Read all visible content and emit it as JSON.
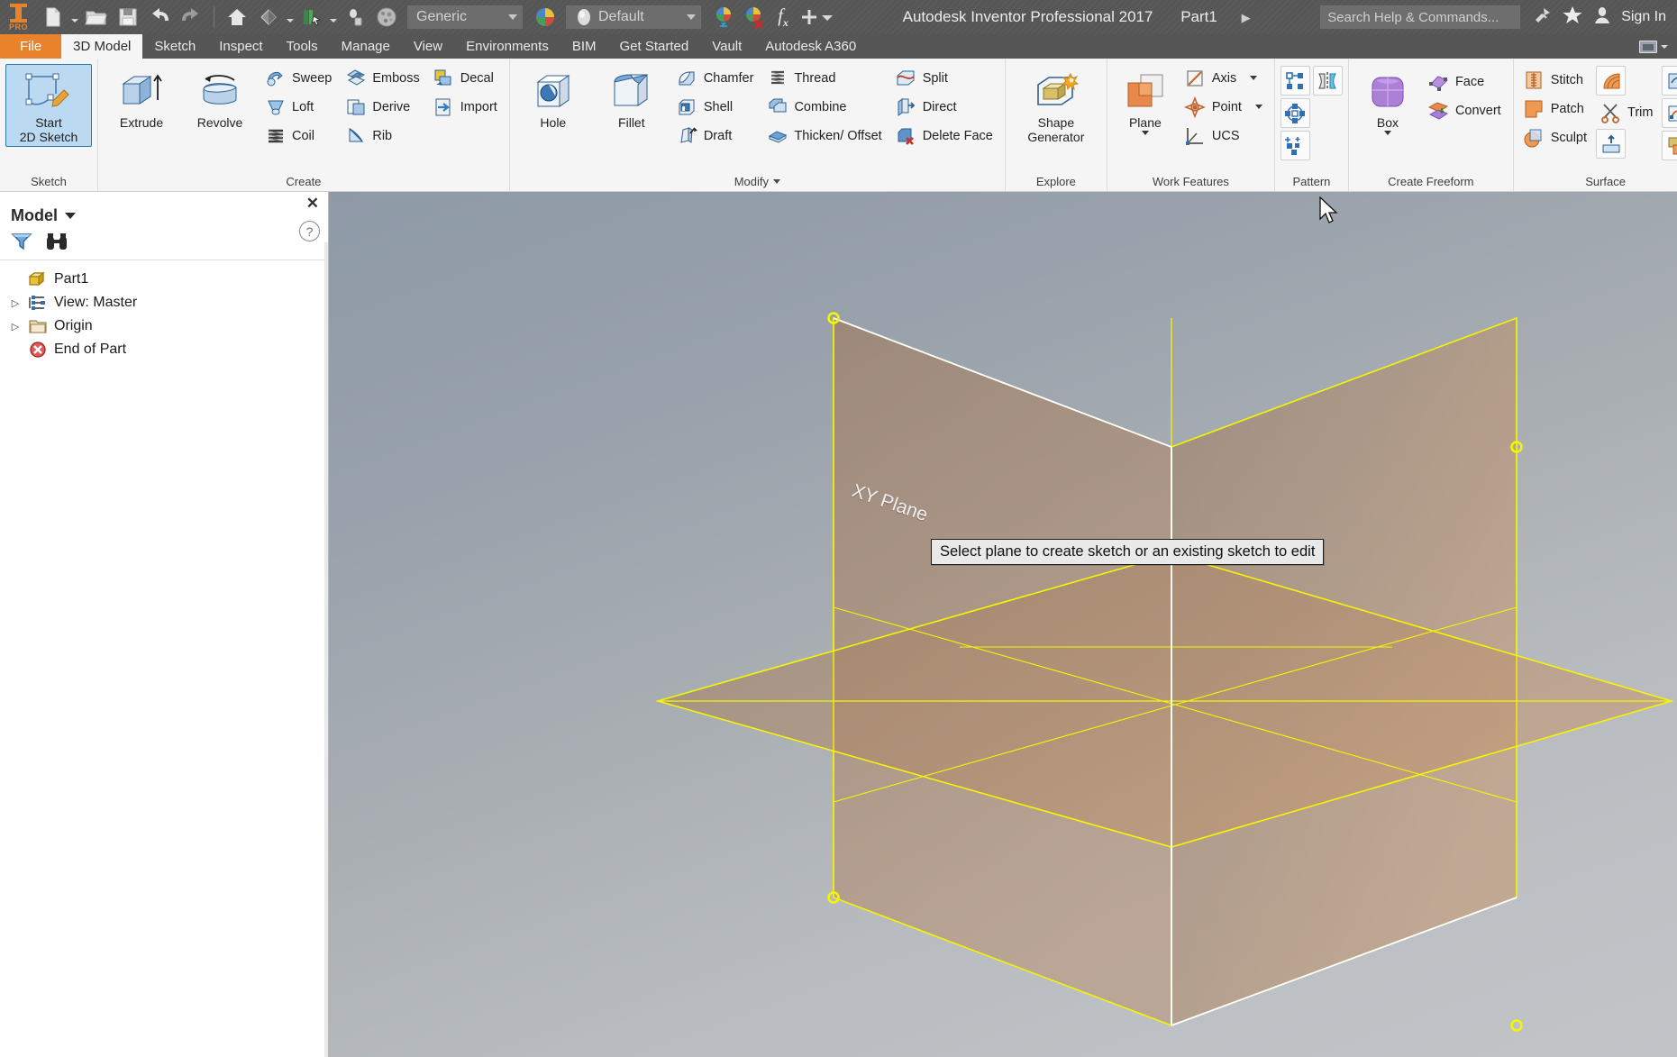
{
  "titlebar": {
    "logo_text": "PRO",
    "app_title": "Autodesk Inventor Professional 2017",
    "document_name": "Part1",
    "title_arrow": "▶",
    "material_value": "Generic",
    "appearance_value": "Default",
    "search_placeholder": "Search Help & Commands...",
    "signin_label": "Sign In",
    "quick_access": [
      {
        "name": "new-file-icon",
        "label": "New"
      },
      {
        "name": "open-file-icon",
        "label": "Open"
      },
      {
        "name": "save-icon",
        "label": "Save"
      },
      {
        "name": "undo-icon",
        "label": "Undo"
      },
      {
        "name": "redo-icon",
        "label": "Redo"
      },
      {
        "name": "home-icon",
        "label": "Home"
      },
      {
        "name": "appearance-icon",
        "label": "Appearance"
      },
      {
        "name": "material-browser-icon",
        "label": "Material Browser"
      },
      {
        "name": "measure-icon",
        "label": "Measure"
      },
      {
        "name": "material-sphere-icon",
        "label": "Material"
      }
    ],
    "right_icons": [
      {
        "name": "satellite-icon",
        "label": "Connection"
      },
      {
        "name": "star-icon",
        "label": "Favorites"
      },
      {
        "name": "user-icon",
        "label": "Account"
      }
    ]
  },
  "tabs": [
    {
      "label": "File",
      "kind": "file"
    },
    {
      "label": "3D Model",
      "kind": "active"
    },
    {
      "label": "Sketch",
      "kind": "normal"
    },
    {
      "label": "Inspect",
      "kind": "normal"
    },
    {
      "label": "Tools",
      "kind": "normal"
    },
    {
      "label": "Manage",
      "kind": "normal"
    },
    {
      "label": "View",
      "kind": "normal"
    },
    {
      "label": "Environments",
      "kind": "normal"
    },
    {
      "label": "BIM",
      "kind": "normal"
    },
    {
      "label": "Get Started",
      "kind": "normal"
    },
    {
      "label": "Vault",
      "kind": "normal"
    },
    {
      "label": "Autodesk A360",
      "kind": "normal"
    }
  ],
  "ribbon": {
    "panels": {
      "sketch": {
        "label": "Sketch",
        "start_sketch_line1": "Start",
        "start_sketch_line2": "2D Sketch"
      },
      "create": {
        "label": "Create",
        "extrude": "Extrude",
        "revolve": "Revolve",
        "col1": [
          "Sweep",
          "Loft",
          "Coil"
        ],
        "col2": [
          "Emboss",
          "Derive",
          "Rib"
        ],
        "col3": [
          "Decal",
          "Import"
        ]
      },
      "modify": {
        "label": "Modify",
        "hole": "Hole",
        "fillet": "Fillet",
        "col1": [
          "Chamfer",
          "Shell",
          "Draft"
        ],
        "col2": [
          "Thread",
          "Combine",
          "Thicken/ Offset"
        ],
        "col3": [
          "Split",
          "Direct",
          "Delete Face"
        ]
      },
      "explore": {
        "label": "Explore",
        "shape_generator_line1": "Shape",
        "shape_generator_line2": "Generator"
      },
      "work_features": {
        "label": "Work Features",
        "plane": "Plane",
        "items": [
          "Axis",
          "Point",
          "UCS"
        ]
      },
      "pattern": {
        "label": "Pattern",
        "icons": [
          "rectangular-pattern-icon",
          "mirror-icon",
          "circular-pattern-icon",
          "sketch-driven-pattern-icon"
        ]
      },
      "freeform": {
        "label": "Create Freeform",
        "box": "Box",
        "items": [
          "Face",
          "Convert"
        ]
      },
      "surface": {
        "label": "Surface",
        "col1": [
          "Stitch",
          "Patch",
          "Sculpt"
        ],
        "col2": [
          "Trim"
        ],
        "icons": [
          "ruled-surface-icon",
          "extend-icon",
          "replace-face-icon",
          "boundary-patch-icon",
          "copy-object-icon"
        ]
      }
    }
  },
  "browser": {
    "title": "Model",
    "close_label": "✕",
    "help_label": "?",
    "filter_icon": "filter-icon",
    "find_icon": "binoculars-icon",
    "tree": [
      {
        "label": "Part1",
        "icon": "part-icon",
        "expander": "",
        "indent": 0
      },
      {
        "label": "View: Master",
        "icon": "view-master-icon",
        "expander": "▷",
        "indent": 0
      },
      {
        "label": "Origin",
        "icon": "folder-icon",
        "expander": "▷",
        "indent": 0
      },
      {
        "label": "End of Part",
        "icon": "end-of-part-icon",
        "expander": "",
        "indent": 0
      }
    ]
  },
  "viewport": {
    "plane_label": "XY Plane",
    "tooltip": "Select plane to create sketch or an existing sketch to edit",
    "colors": {
      "plane_edge": "#f5f500",
      "plane_fill": "#b08a6a",
      "highlight_edge": "#ffffff",
      "background_top": "#8f9aa8",
      "background_bottom": "#c2c5c8"
    }
  }
}
